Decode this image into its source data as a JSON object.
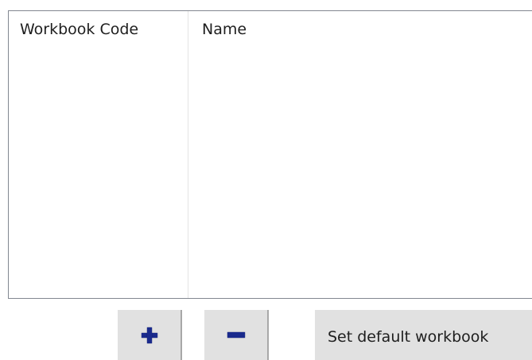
{
  "workbook_list": {
    "columns": [
      {
        "label": "Workbook Code"
      },
      {
        "label": "Name"
      }
    ],
    "rows": []
  },
  "toolbar": {
    "add_icon": "plus-icon",
    "remove_icon": "minus-icon",
    "set_default_label": "Set default workbook"
  },
  "colors": {
    "icon_blue": "#1a2a8c",
    "button_bg": "#e1e1e1"
  }
}
